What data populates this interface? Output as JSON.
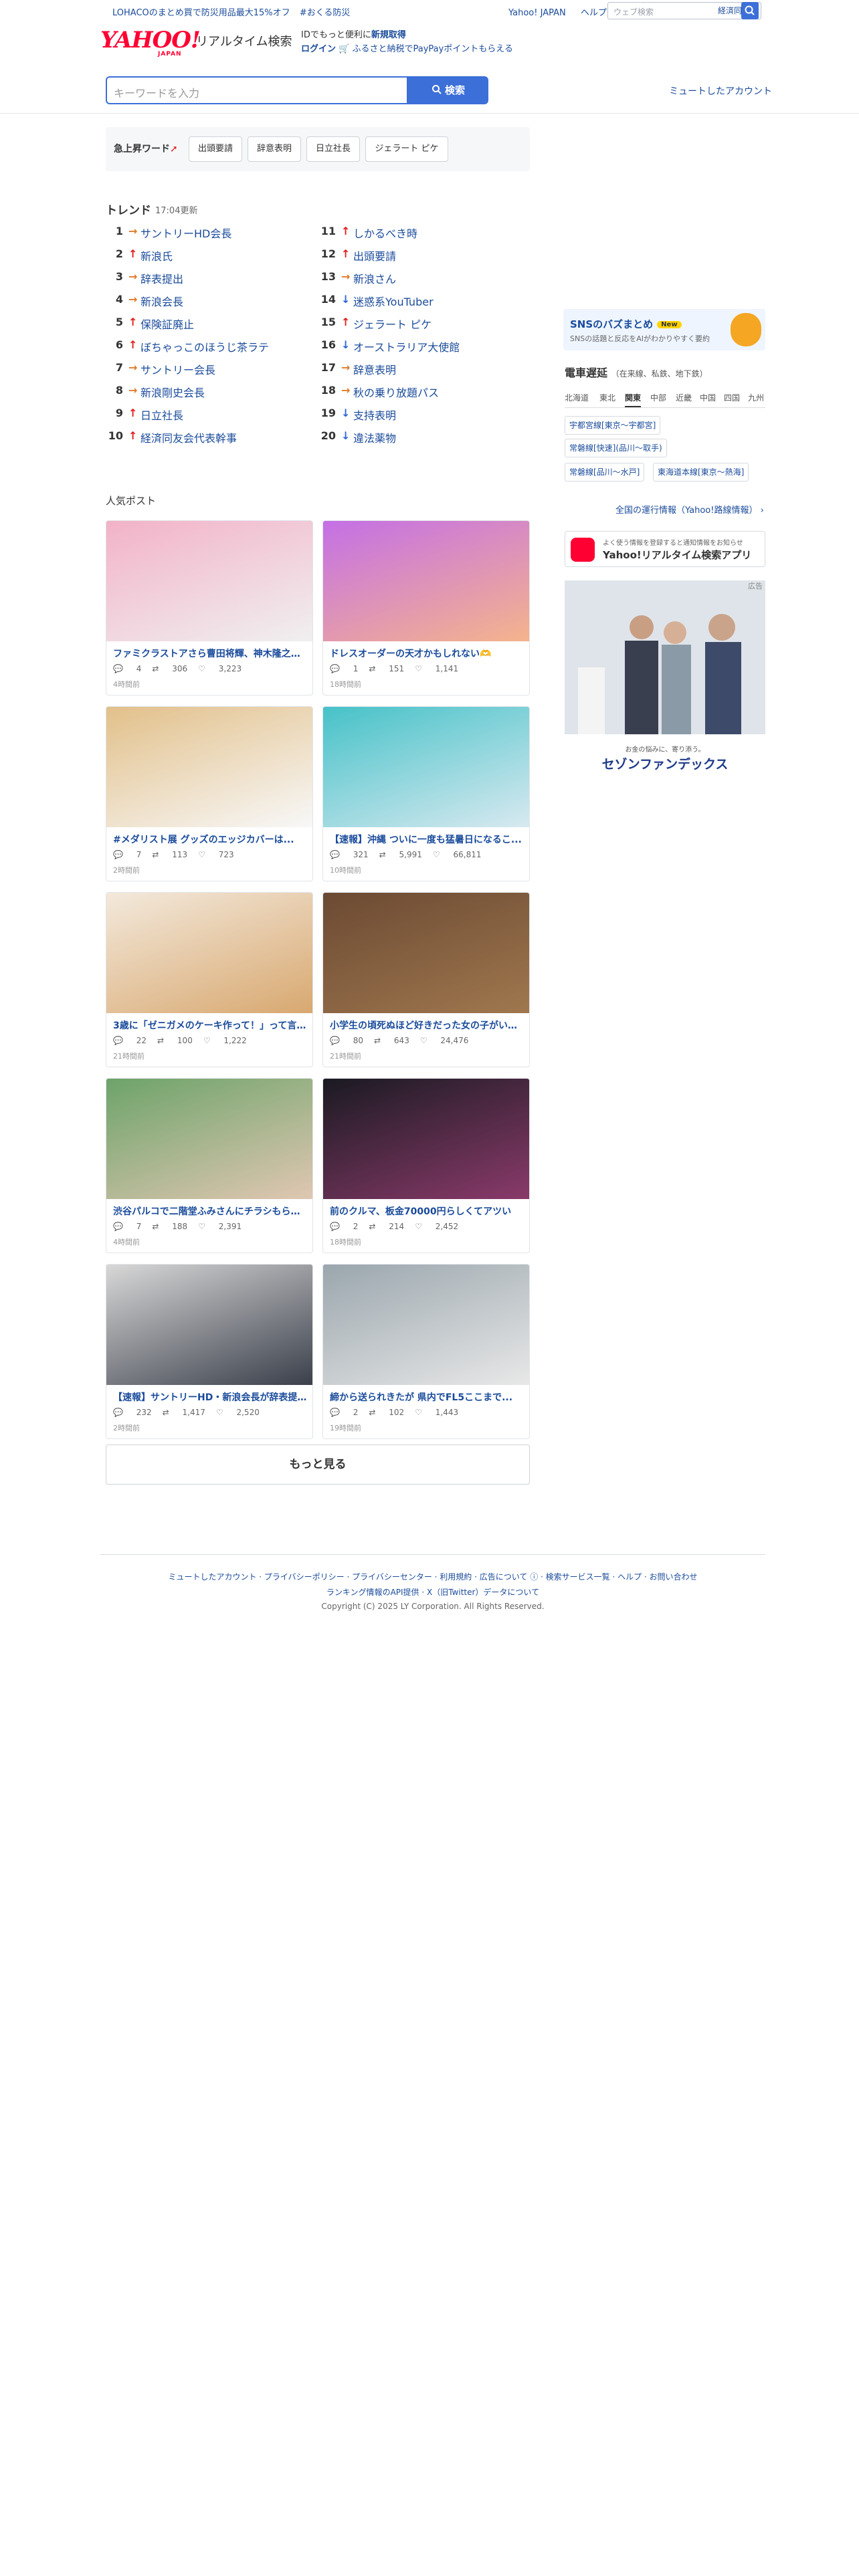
{
  "topbar": {
    "promo": "LOHACOのまとめ買で防災用品最大15%オフ",
    "promo_tag": "#おくる防災",
    "link_yahoo": "Yahoo! JAPAN",
    "link_help": "ヘルプ",
    "websearch_placeholder": "ウェブ検索",
    "websearch_keyword": "経済同友会"
  },
  "header": {
    "logo_text": "YAHOO!",
    "logo_sub": "JAPAN",
    "title": "リアルタイム検索",
    "login_line1_pre": "IDでもっと便利に",
    "login_line1_link": "新規取得",
    "login_line2_link": "ログイン",
    "login_line2_rest": "🛒 ふるさと納税でPayPayポイントもらえる",
    "search_placeholder": "キーワードを入力",
    "search_button": "検索",
    "mute_link": "ミュートしたアカウント"
  },
  "urgent": {
    "label": "急上昇ワード",
    "chips": [
      "出頭要請",
      "辞意表明",
      "日立社長",
      "ジェラート ピケ"
    ]
  },
  "trend": {
    "title": "トレンド",
    "time": "17:04更新",
    "items": [
      {
        "rank": "1",
        "dir": "flat",
        "word": "サントリーHD会長"
      },
      {
        "rank": "2",
        "dir": "up",
        "word": "新浪氏"
      },
      {
        "rank": "3",
        "dir": "flat",
        "word": "辞表提出"
      },
      {
        "rank": "4",
        "dir": "flat",
        "word": "新浪会長"
      },
      {
        "rank": "5",
        "dir": "up",
        "word": "保険証廃止"
      },
      {
        "rank": "6",
        "dir": "up",
        "word": "ぼちゃっこのほうじ茶ラテ"
      },
      {
        "rank": "7",
        "dir": "flat",
        "word": "サントリー会長"
      },
      {
        "rank": "8",
        "dir": "flat",
        "word": "新浪剛史会長"
      },
      {
        "rank": "9",
        "dir": "up",
        "word": "日立社長"
      },
      {
        "rank": "10",
        "dir": "up",
        "word": "経済同友会代表幹事"
      },
      {
        "rank": "11",
        "dir": "up",
        "word": "しかるべき時"
      },
      {
        "rank": "12",
        "dir": "up",
        "word": "出頭要請"
      },
      {
        "rank": "13",
        "dir": "flat",
        "word": "新浪さん"
      },
      {
        "rank": "14",
        "dir": "down",
        "word": "迷惑系YouTuber"
      },
      {
        "rank": "15",
        "dir": "up",
        "word": "ジェラート ピケ"
      },
      {
        "rank": "16",
        "dir": "down",
        "word": "オーストラリア大使館"
      },
      {
        "rank": "17",
        "dir": "flat",
        "word": "辞意表明"
      },
      {
        "rank": "18",
        "dir": "flat",
        "word": "秋の乗り放題パス"
      },
      {
        "rank": "19",
        "dir": "down",
        "word": "支持表明"
      },
      {
        "rank": "20",
        "dir": "down",
        "word": "違法薬物"
      }
    ]
  },
  "popular": {
    "title": "人気ポスト",
    "more_button": "もっと見る",
    "posts": [
      {
        "title": "ファミクラストアさら曹田将輝、神木隆之介...",
        "replies": "4",
        "reposts": "306",
        "likes": "3,223",
        "ago": "4時間前",
        "colors": [
          "#f2b2c8",
          "#f0f0f0"
        ]
      },
      {
        "title": "ドレスオーダーの天才かもしれない🫶",
        "replies": "1",
        "reposts": "151",
        "likes": "1,141",
        "ago": "18時間前",
        "colors": [
          "#c46fe6",
          "#f5b48c"
        ]
      },
      {
        "title": "#メダリスト展 グッズのエッジカバーは...",
        "replies": "7",
        "reposts": "113",
        "likes": "723",
        "ago": "2時間前",
        "colors": [
          "#e2c08a",
          "#f8f8f8"
        ]
      },
      {
        "title": "【速報】沖縄 ついに一度も猛暑日になるこ...",
        "replies": "321",
        "reposts": "5,991",
        "likes": "66,811",
        "ago": "10時間前",
        "colors": [
          "#46c2c8",
          "#d8e9f0"
        ]
      },
      {
        "title": "3歳に「ゼニガメのケーキ作って！」って言わ...",
        "replies": "22",
        "reposts": "100",
        "likes": "1,222",
        "ago": "21時間前",
        "colors": [
          "#f3e9dc",
          "#d8a870"
        ]
      },
      {
        "title": "小学生の頃死ぬほど好きだった女の子がいい...",
        "replies": "80",
        "reposts": "643",
        "likes": "24,476",
        "ago": "21時間前",
        "colors": [
          "#6b4a33",
          "#a0774e"
        ]
      },
      {
        "title": "渋谷パルコで二階堂ふみさんにチラシもらっ...",
        "replies": "7",
        "reposts": "188",
        "likes": "2,391",
        "ago": "4時間前",
        "colors": [
          "#6da36a",
          "#e0c7b2"
        ]
      },
      {
        "title": "前のクルマ、板金70000円らしくてアツい",
        "replies": "2",
        "reposts": "214",
        "likes": "2,452",
        "ago": "18時間前",
        "colors": [
          "#1a1a22",
          "#8a3a6a"
        ]
      },
      {
        "title": "【速報】サントリーHD・新浪会長が辞表提出...",
        "replies": "232",
        "reposts": "1,417",
        "likes": "2,520",
        "ago": "2時間前",
        "colors": [
          "#d8d8d8",
          "#3a3f4a"
        ]
      },
      {
        "title": "締から送られきたが 県内でFL5ここまで...",
        "replies": "2",
        "reposts": "102",
        "likes": "1,443",
        "ago": "19時間前",
        "colors": [
          "#9aa6ad",
          "#e8e8e8"
        ]
      }
    ]
  },
  "sidebar": {
    "sns_title": "SNSのバズまとめ",
    "sns_badge": "New",
    "sns_sub": "SNSの話題と反応をAIがわかりやすく要約",
    "train_title": "電車遅延",
    "train_sub": "（在来線、私鉄、地下鉄）",
    "tabs": [
      "北海道",
      "東北",
      "関東",
      "中部",
      "近畿",
      "中国",
      "四国",
      "九州"
    ],
    "active_tab": "関東",
    "routes": [
      "宇都宮線[東京〜宇都宮]",
      "常磐線[快速](品川〜取手)",
      "常磐線[品川〜水戸]",
      "東海道本線[東京〜熱海]"
    ],
    "all_train": "全国の運行情報（Yahoo!路線情報）",
    "app_small": "よく使う情報を登録すると通知情報をお知らせ",
    "app_large": "Yahoo!リアルタイム検索アプリ",
    "ad_label": "広告",
    "ad_sub": "お金の悩みに、寄り添う。",
    "ad_brand": "セゾンファンデックス"
  },
  "footer": {
    "line1": "ミュートしたアカウント · プライバシーポリシー · プライバシーセンター · 利用規約 · 広告について ⓘ · 検索サービス一覧 · ヘルプ · お問い合わせ",
    "line2": "ランキング情報のAPI提供 · X（旧Twitter）データについて",
    "line3": "Copyright (C) 2025 LY Corporation. All Rights Reserved."
  }
}
